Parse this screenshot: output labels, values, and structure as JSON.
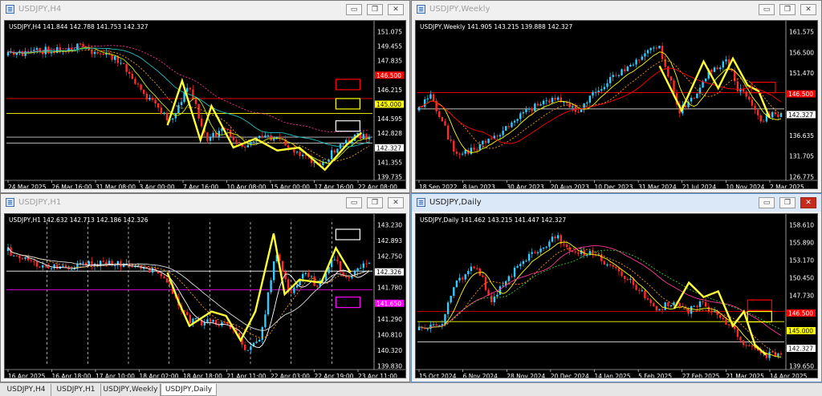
{
  "windows": [
    {
      "title": "USDJPY,H4",
      "ohlc": "USDJPY,H4  141.844 142.788 141.753 142.327",
      "active": false,
      "price_labels": [
        "151.075",
        "149.455",
        "147.835",
        "146.500",
        "146.215",
        "145.000",
        "144.595",
        "142.828",
        "142.327",
        "141.355",
        "139.735"
      ],
      "date_labels": [
        "24 Mar 2025",
        "26 Mar 16:00",
        "31 Mar 08:00",
        "3 Apr 00:00",
        "7 Apr 16:00",
        "10 Apr 08:00",
        "15 Apr 00:00",
        "17 Apr 16:00",
        "22 Apr 08:00"
      ]
    },
    {
      "title": "USDJPY,Weekly",
      "ohlc": "USDJPY,Weekly  141.905 143.215 139.888 142.327",
      "active": false,
      "price_labels": [
        "161.575",
        "156.500",
        "151.470",
        "146.500",
        "142.327",
        "136.635",
        "131.705",
        "126.775"
      ],
      "date_labels": [
        "18 Sep 2022",
        "8 Jan 2023",
        "30 Apr 2023",
        "20 Aug 2023",
        "10 Dec 2023",
        "31 Mar 2024",
        "21 Jul 2024",
        "10 Nov 2024",
        "2 Mar 2025"
      ]
    },
    {
      "title": "USDJPY,H1",
      "ohlc": "USDJPY,H1  142.632 142.713 142.186 142.326",
      "active": false,
      "price_labels": [
        "143.230",
        "142.893",
        "142.750",
        "142.326",
        "141.780",
        "141.650",
        "141.290",
        "140.810",
        "140.320",
        "139.830"
      ],
      "date_labels": [
        "16 Apr 2025",
        "16 Apr 18:00",
        "17 Apr 10:00",
        "18 Apr 02:00",
        "18 Apr 18:00",
        "21 Apr 11:00",
        "22 Apr 03:00",
        "22 Apr 19:00",
        "23 Apr 11:00"
      ]
    },
    {
      "title": "USDJPY,Daily",
      "ohlc": "USDJPY,Daily  141.462 143.215 141.447 142.327",
      "active": true,
      "price_labels": [
        "158.610",
        "155.890",
        "153.170",
        "150.450",
        "147.730",
        "146.500",
        "145.000",
        "142.327",
        "139.650"
      ],
      "date_labels": [
        "15 Oct 2024",
        "6 Nov 2024",
        "28 Nov 2024",
        "20 Dec 2024",
        "14 Jan 2025",
        "5 Feb 2025",
        "27 Feb 2025",
        "21 Mar 2025",
        "14 Apr 2025"
      ]
    }
  ],
  "window_controls": {
    "minimize": "▭",
    "restore": "❐",
    "close": "✕"
  },
  "tabs": [
    "USDJPY,H4",
    "USDJPY,H1",
    "USDJPY,Weekly",
    "USDJPY,Daily"
  ],
  "active_tab": 3,
  "colors": {
    "bull": "#33ccff",
    "bear": "#ff2a2a",
    "zigzag": "#ffff33",
    "support": "#ffff00",
    "resistance": "#ff0000",
    "accent_box": "#ff00ff",
    "chart_bg": "#000000"
  }
}
